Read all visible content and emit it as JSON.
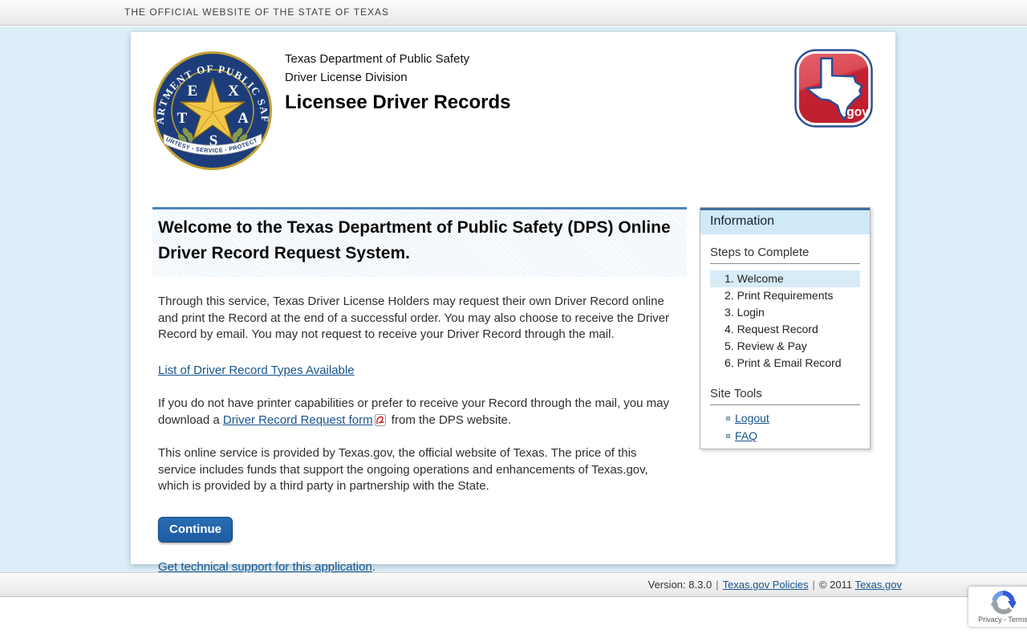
{
  "topbar": {
    "text": "THE OFFICIAL WEBSITE OF THE STATE OF TEXAS"
  },
  "header": {
    "agency": "Texas Department of Public Safety",
    "division": "Driver License Division",
    "app_title": "Licensee Driver Records",
    "texas_gov_label": ".gov"
  },
  "seal": {
    "ring_text": "DEPARTMENT OF PUBLIC SAFETY",
    "star_letters": [
      "E",
      "X",
      "T",
      "A",
      "S"
    ],
    "ribbon_text": "COURTESY - SERVICE - PROTECTION"
  },
  "main": {
    "welcome_heading": "Welcome to the Texas Department of Public Safety (DPS) Online Driver Record Request System.",
    "para1": "Through this service, Texas Driver License Holders may request their own Driver Record online and print the Record at the end of a successful order. You may also choose to receive the Driver Record by email. You may not request to receive your Driver Record through the mail.",
    "record_types_link": "List of Driver Record Types Available",
    "para2_before": "If you do not have printer capabilities or prefer to receive your Record through the mail, you may download a ",
    "para2_link": "Driver Record Request form",
    "para2_after": " from the DPS website.",
    "para3": "This online service is provided by Texas.gov, the official website of Texas. The price of this service includes funds that support the ongoing operations and enhancements of Texas.gov, which is provided by a third party in partnership with the State.",
    "continue_label": "Continue",
    "support_link": "Get technical support for this application",
    "support_suffix": "."
  },
  "sidebar": {
    "title": "Information",
    "steps_heading": "Steps to Complete",
    "steps": [
      "1. Welcome",
      "2. Print Requirements",
      "3. Login",
      "4. Request Record",
      "5. Review & Pay",
      "6. Print & Email Record"
    ],
    "active_step": "1. Welcome",
    "tools_heading": "Site Tools",
    "tools": [
      "Logout",
      "FAQ"
    ]
  },
  "footer": {
    "version_label": "Version: 8.3.0",
    "separator": "|",
    "policies_link": "Texas.gov Policies",
    "copyright": "© 2011",
    "brand_link": "Texas.gov"
  },
  "recaptcha": {
    "label": "Privacy - Terms"
  },
  "colors": {
    "page_background": "#dceef7",
    "button_blue": "#1d5ca2",
    "link_blue": "#17548e",
    "accent_border_blue": "#4d83b8",
    "sidebar_header_blue": "#cfe9f8",
    "seal_navy": "#1d3d7a",
    "seal_gold": "#f2c84b",
    "texasgov_red": "#c22231"
  }
}
